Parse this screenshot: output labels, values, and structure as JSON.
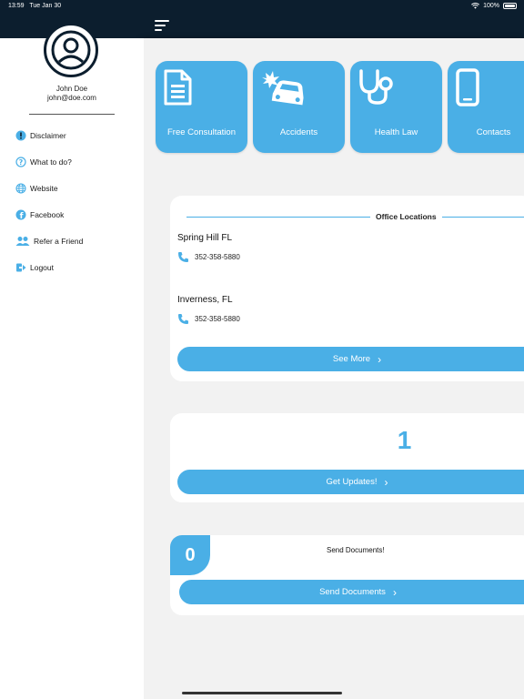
{
  "status_bar": {
    "time": "13:59",
    "date": "Tue Jan 30",
    "battery": "100%",
    "battery_level": 1.0
  },
  "drawer": {
    "user_name": "John Doe",
    "user_email": "john@doe.com",
    "items": [
      {
        "label": "Disclaimer",
        "icon": "info-icon"
      },
      {
        "label": "What to do?",
        "icon": "question-icon"
      },
      {
        "label": "Website",
        "icon": "globe-icon"
      },
      {
        "label": "Facebook",
        "icon": "facebook-icon"
      },
      {
        "label": "Refer a Friend",
        "icon": "people-icon"
      },
      {
        "label": "Logout",
        "icon": "logout-icon"
      }
    ]
  },
  "tiles": [
    {
      "label": "Free Consultation",
      "icon": "document-icon"
    },
    {
      "label": "Accidents",
      "icon": "car-crash-icon"
    },
    {
      "label": "Health Law",
      "icon": "stethoscope-icon"
    },
    {
      "label": "Contacts",
      "icon": "phone-device-icon"
    }
  ],
  "office": {
    "title": "Office Locations",
    "locations": [
      {
        "name": "Spring Hill FL",
        "phone": "352-358-5880"
      },
      {
        "name": "Inverness, FL",
        "phone": "352-358-5880"
      }
    ],
    "see_more_label": "See More"
  },
  "updates": {
    "count": "1",
    "button_label": "Get Updates!"
  },
  "documents": {
    "count": "0",
    "title": "Send Documents!",
    "button_label": "Send Documents"
  },
  "colors": {
    "accent": "#4aafe6",
    "header": "#0c1e2e",
    "background": "#f2f2f2"
  }
}
